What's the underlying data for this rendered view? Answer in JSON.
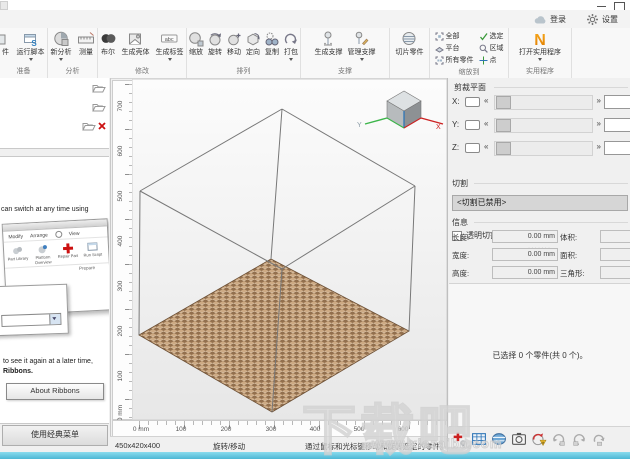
{
  "topbar": {
    "login": "登录",
    "settings": "设置"
  },
  "ribbon": {
    "groups": [
      {
        "label": "准备",
        "items": [
          {
            "label": "件"
          },
          {
            "label": "运行脚本"
          }
        ]
      },
      {
        "label": "分析",
        "items": [
          {
            "label": "新分析"
          },
          {
            "label": "测量"
          }
        ]
      },
      {
        "label": "修改",
        "items": [
          {
            "label": "布尔"
          },
          {
            "label": "生成壳体"
          },
          {
            "label": "生成标签"
          }
        ]
      },
      {
        "label": "排列",
        "items": [
          {
            "label": "缩放"
          },
          {
            "label": "旋转"
          },
          {
            "label": "移动"
          },
          {
            "label": "定向"
          },
          {
            "label": "复制"
          },
          {
            "label": "打包"
          }
        ]
      },
      {
        "label": "支撑",
        "items": [
          {
            "label": "生成支撑"
          },
          {
            "label": "管理支撑"
          }
        ]
      },
      {
        "label": "",
        "items": [
          {
            "label": "切片零件"
          }
        ]
      },
      {
        "label": "缩放到",
        "items": [
          {
            "label": "全部"
          },
          {
            "label": "平台"
          },
          {
            "label": "所有零件"
          },
          {
            "label": "选定"
          },
          {
            "label": "区域"
          },
          {
            "label": "点"
          }
        ]
      },
      {
        "label": "实用程序",
        "items": [
          {
            "label": "打开实用程序"
          }
        ]
      }
    ]
  },
  "icons": {
    "abc": "abc",
    "n": "N"
  },
  "left": {
    "help": {
      "line1": "can switch at any time using",
      "line2": "to see it again at a later time,",
      "line3": "Ribbons.",
      "about_button": "About Ribbons"
    },
    "mock": {
      "tabs": [
        "Modify",
        "Arrange",
        "View"
      ],
      "items": [
        "Part Library",
        "Platform Overview",
        "Repair Part",
        "Run Script"
      ],
      "group": "Prepare"
    },
    "classic_button": "使用经典菜单"
  },
  "viewport": {
    "vruler": [
      "700",
      "600",
      "500",
      "400",
      "300",
      "200",
      "100",
      "0 mm"
    ],
    "hruler": [
      "0 mm",
      "100",
      "200",
      "300",
      "400",
      "500",
      "600"
    ],
    "cube": {
      "x": "X",
      "y": "Y"
    }
  },
  "right": {
    "clip": {
      "title": "剪裁平面",
      "x": "X:",
      "y": "Y:",
      "z": "Z:",
      "arrow_l": "«",
      "arrow_r": "»",
      "transparent": "透明切割"
    },
    "cut": {
      "title": "切割",
      "dropdown": "<切割已禁用>"
    },
    "info": {
      "title": "信息",
      "length": "长度:",
      "width": "宽度:",
      "height": "高度:",
      "volume": "体积:",
      "area": "面积:",
      "triangles": "三角形:",
      "length_val": "0.00 mm",
      "width_val": "0.00 mm",
      "height_val": "0.00 mm"
    },
    "selection": "已选择 0 个零件(共 0 个)。"
  },
  "status": {
    "dims": "450x420x400",
    "mode": "旋转/移动",
    "hint": "通过鼠标和光标键移动和旋转选定的零件。"
  },
  "watermark": {
    "big": "下载吧",
    "url": "www.xiazaiba.com"
  },
  "colors": {
    "axis_x_red": "#cc2222",
    "axis_y_green": "#3cb54a",
    "axis_z_blue": "#2e75b6",
    "platform_tan": "#c9a781",
    "logo_orange": "#e8890c",
    "bottom_bar_blue": "#5ec7de"
  }
}
